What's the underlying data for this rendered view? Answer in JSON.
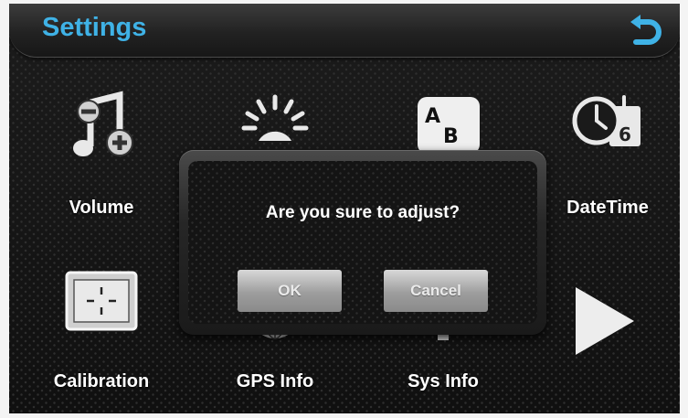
{
  "header": {
    "title": "Settings",
    "back_icon": "back-arrow-icon"
  },
  "tiles": [
    {
      "label": "Volume",
      "icon": "music-note-volume-icon"
    },
    {
      "label": "",
      "icon": "backlight-bulb-icon"
    },
    {
      "label": "",
      "icon": "language-abc-icon"
    },
    {
      "label": "DateTime",
      "icon": "clock-calendar-icon"
    },
    {
      "label": "Calibration",
      "icon": "crosshair-calibration-icon"
    },
    {
      "label": "GPS Info",
      "icon": "satellite-globe-icon"
    },
    {
      "label": "Sys Info",
      "icon": "gear-icon"
    },
    {
      "label": "",
      "icon": "next-page-arrow-icon"
    }
  ],
  "dialog": {
    "message": "Are you sure to adjust?",
    "ok_label": "OK",
    "cancel_label": "Cancel"
  },
  "colors": {
    "accent": "#3fb2e6",
    "background": "#151515"
  }
}
